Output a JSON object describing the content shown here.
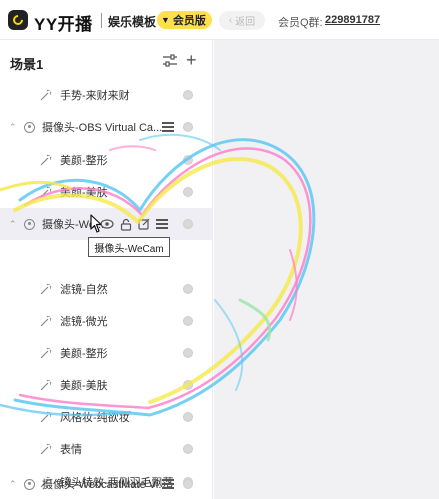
{
  "header": {
    "app_title": "YY开播",
    "template": "娱乐模板",
    "vip_label": "会员版",
    "back_label": "返回",
    "group_label": "会员Q群:",
    "group_number": "229891787"
  },
  "scene": {
    "title": "场景1"
  },
  "rows": [
    {
      "kind": "fx",
      "label": "手势-来财来财"
    },
    {
      "kind": "source",
      "label": "摄像头-OBS Virtual Ca..."
    },
    {
      "kind": "fx",
      "label": "美颜-整形"
    },
    {
      "kind": "fx",
      "label": "美颜-美肤"
    },
    {
      "kind": "source",
      "label": "摄像头-We..."
    },
    {
      "kind": "fx",
      "label": "滤镜-自然"
    },
    {
      "kind": "fx",
      "label": "滤镜-微光"
    },
    {
      "kind": "fx",
      "label": "美颜-整形"
    },
    {
      "kind": "fx",
      "label": "美颜-美肤"
    },
    {
      "kind": "fx",
      "label": "风格妆-纯欲妆"
    },
    {
      "kind": "fx",
      "label": "表情"
    },
    {
      "kind": "fx",
      "label": "镜头特效-两侧羽毛飘落"
    },
    {
      "kind": "source",
      "label": "摄像头-WebcastMate Vi..."
    }
  ],
  "tooltip": "摄像头-WeCam",
  "colors": {
    "accent_yellow": "#ffe04a",
    "header_border": "#ebebeb",
    "right_bg": "#f1f1f3",
    "heart_blue": "#5ec8f2",
    "heart_pink": "#ff7ac8",
    "heart_yellow": "#f5e84a",
    "heart_green": "#9be6a8"
  },
  "icons": {
    "logo": "yy-logo-icon",
    "crown": "crown-icon",
    "back": "chevron-left-icon",
    "filter": "filter-icon",
    "add": "plus-icon",
    "camera": "camera-source-icon",
    "effect": "magic-wand-icon",
    "visibility": "eye-icon",
    "lock": "unlock-icon",
    "edit": "edit-icon",
    "menu": "menu-icon",
    "status": "status-dot-icon"
  }
}
